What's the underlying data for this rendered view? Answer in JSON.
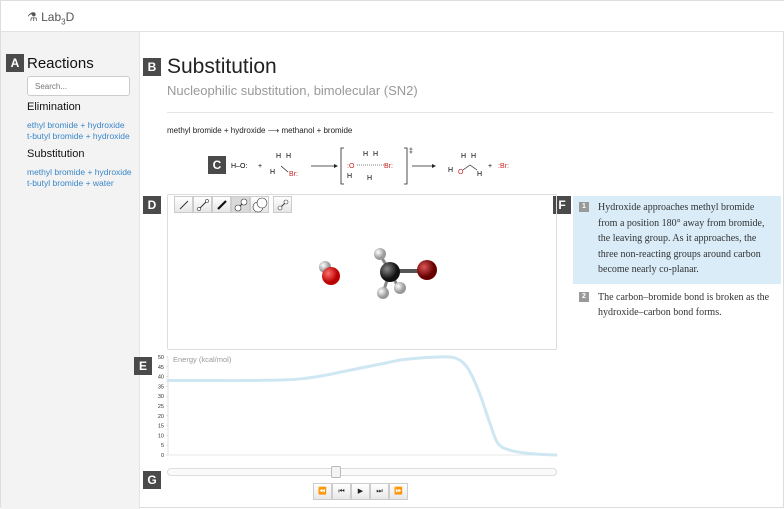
{
  "app": {
    "brand_prefix": "Lab",
    "brand_sub": "3",
    "brand_suffix": "D",
    "flask_icon": "flask-icon"
  },
  "labels": [
    "A",
    "B",
    "C",
    "D",
    "E",
    "F",
    "G"
  ],
  "sidebar": {
    "title": "Reactions",
    "search_placeholder": "Search...",
    "groups": [
      {
        "title": "Elimination",
        "items": [
          "ethyl bromide + hydroxide",
          "t-butyl bromide + hydroxide"
        ]
      },
      {
        "title": "Substitution",
        "items": [
          "methyl bromide + hydroxide",
          "t-butyl bromide + water"
        ]
      }
    ]
  },
  "main": {
    "title": "Substitution",
    "subtitle": "Nucleophilic substitution, bimolecular (SN2)",
    "equation": {
      "left": "methyl bromide + hydroxide",
      "right": "methanol + bromide"
    },
    "scheme": {
      "hydroxide": "H–O:",
      "plus": "+",
      "bromine": "Br",
      "hydrogen": "H",
      "oxygen": "O",
      "ts_mark": "‡"
    },
    "toolbar": [
      "line-bond-icon",
      "ball-stick-icon",
      "thick-bond-icon",
      "ball-stick-large-icon",
      "spacefill-icon",
      "ball-stick-small-icon"
    ],
    "active_tool": 3,
    "colors": {
      "oxygen": "#cc1111",
      "bromine": "#8b1010",
      "carbon": "#333333",
      "hydrogen": "#dddddd",
      "curve": "#cfe6f3",
      "highlight": "#d9ecf7"
    }
  },
  "steps": [
    {
      "num": "1",
      "text": "Hydroxide approaches methyl bromide from a position 180° away from bromide, the leaving group. As it approaches, the three non-reacting groups around carbon become nearly co-planar.",
      "active": true
    },
    {
      "num": "2",
      "text": "The carbon–bromide bond is broken as the hydroxide–carbon bond forms.",
      "active": false
    }
  ],
  "chart_data": {
    "type": "line",
    "ylabel": "Energy (kcal/mol)",
    "ylim": [
      0,
      50
    ],
    "yticks": [
      0,
      5,
      10,
      15,
      20,
      25,
      30,
      35,
      40,
      45,
      50
    ],
    "x": [
      0,
      0.1,
      0.2,
      0.3,
      0.35,
      0.4,
      0.45,
      0.5,
      0.55,
      0.6,
      0.65,
      0.7,
      0.74,
      0.77,
      0.8,
      0.83,
      0.85,
      0.88,
      0.92,
      0.96,
      1
    ],
    "values": [
      38,
      38,
      38,
      38.3,
      39,
      40.5,
      42.5,
      44.5,
      46.5,
      48.5,
      49.5,
      50,
      49.5,
      45,
      33,
      16,
      6,
      2.5,
      1,
      0.3,
      0
    ]
  },
  "playback": {
    "progress": 0.43,
    "buttons": [
      "⏪",
      "⏮",
      "▶",
      "⏭",
      "⏩"
    ],
    "names": [
      "rewind-icon",
      "step-back-icon",
      "play-icon",
      "step-forward-icon",
      "fast-forward-icon"
    ]
  }
}
